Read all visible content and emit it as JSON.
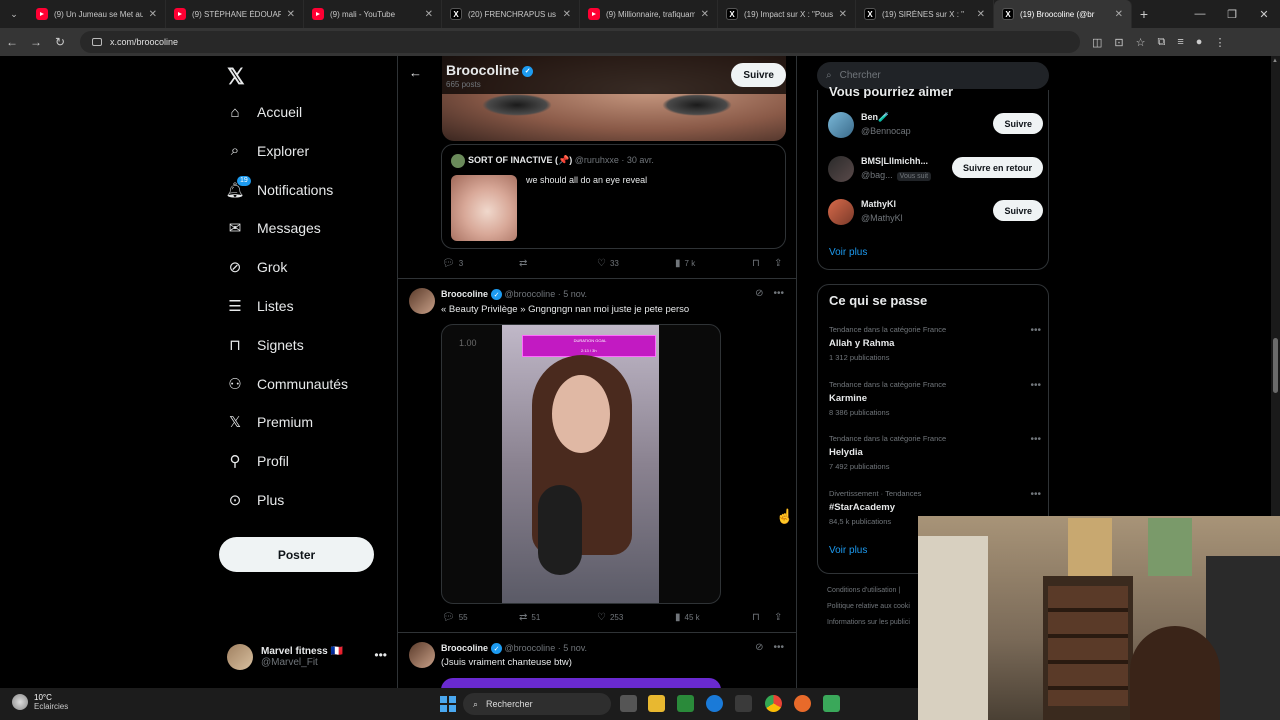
{
  "browser": {
    "tabs": [
      {
        "title": "(9) Un Jumeau se Met au",
        "icon": "youtube-icon"
      },
      {
        "title": "(9) STÉPHANE ÉDOUARD",
        "icon": "youtube-icon"
      },
      {
        "title": "(9) mali - YouTube",
        "icon": "youtube-icon"
      },
      {
        "title": "(20) FRENCHRAPUS us su",
        "icon": "x-icon"
      },
      {
        "title": "(9) Millionnaire, trafiquam",
        "icon": "youtube-icon"
      },
      {
        "title": "(19) Impact sur X : \"Pous",
        "icon": "x-icon"
      },
      {
        "title": "(19) SIRÈNES sur X : \"",
        "icon": "x-icon"
      },
      {
        "title": "(19) Broocoline (@br",
        "icon": "x-icon",
        "active": true
      }
    ],
    "url": "x.com/broocoline"
  },
  "sidebar": {
    "nav": [
      {
        "label": "Accueil",
        "icon": "home-icon"
      },
      {
        "label": "Explorer",
        "icon": "search-icon"
      },
      {
        "label": "Notifications",
        "icon": "bell-icon",
        "badge": "19"
      },
      {
        "label": "Messages",
        "icon": "envelope-icon"
      },
      {
        "label": "Grok",
        "icon": "grok-icon"
      },
      {
        "label": "Listes",
        "icon": "list-icon"
      },
      {
        "label": "Signets",
        "icon": "bookmark-icon"
      },
      {
        "label": "Communautés",
        "icon": "people-icon"
      },
      {
        "label": "Premium",
        "icon": "x-icon"
      },
      {
        "label": "Profil",
        "icon": "person-icon"
      },
      {
        "label": "Plus",
        "icon": "more-circle-icon"
      }
    ],
    "post_button": "Poster",
    "account": {
      "name": "Marvel fitness",
      "flag": "🇫🇷",
      "handle": "@Marvel_Fit"
    }
  },
  "profile_header": {
    "name": "Broocoline",
    "post_count": "665 posts",
    "follow_label": "Suivre"
  },
  "feed": {
    "quoted": {
      "name": "SORT OF INACTIVE (📌)",
      "handle": "@ruruhxxe",
      "date": "30 avr.",
      "text": "we should all do an eye reveal"
    },
    "tweet1_stats": {
      "replies": "3",
      "likes": "33",
      "views": "7 k"
    },
    "tweet2": {
      "name": "Broocoline",
      "handle": "@broocoline",
      "date": "5 nov.",
      "text": "« Beauty Privilège » Gngngngn nan moi juste je pete perso",
      "video_speed": "1.00",
      "overlay_title": "DURATION GOAL",
      "overlay_value": "2:13 / 3h",
      "stats": {
        "replies": "55",
        "retweets": "51",
        "likes": "253",
        "views": "45 k"
      }
    },
    "tweet3": {
      "name": "Broocoline",
      "handle": "@broocoline",
      "date": "5 nov.",
      "text": "(Jsuis vraiment chanteuse btw)"
    }
  },
  "right": {
    "search_placeholder": "Chercher",
    "who_to_follow": {
      "title": "Vous pourriez aimer",
      "users": [
        {
          "name": "Ben🧪",
          "handle": "@Bennocap",
          "button": "Suivre"
        },
        {
          "name": "BMS|Lllmichh...",
          "handle": "@bag...",
          "note": "Vous suit",
          "button": "Suivre en retour"
        },
        {
          "name": "MathyKl",
          "handle": "@MathyKl",
          "button": "Suivre"
        }
      ],
      "more": "Voir plus"
    },
    "trends": {
      "title": "Ce qui se passe",
      "items": [
        {
          "context": "Tendance dans la catégorie France",
          "name": "Allah y Rahma",
          "count": "1 312 publications"
        },
        {
          "context": "Tendance dans la catégorie France",
          "name": "Karmine",
          "count": "8 386 publications"
        },
        {
          "context": "Tendance dans la catégorie France",
          "name": "Helydia",
          "count": "7 492 publications"
        },
        {
          "context": "Divertissement · Tendances",
          "name": "#StarAcademy",
          "count": "84,5 k publications"
        }
      ],
      "more": "Voir plus"
    },
    "footer": [
      "Conditions d'utilisation |",
      "Politique relative aux cooki",
      "Informations sur les publici"
    ]
  },
  "taskbar": {
    "temp": "10°C",
    "weather": "Eclaircies",
    "search": "Rechercher"
  },
  "colors": {
    "accent": "#1d9bf0",
    "background": "#000000",
    "border": "#2f3336"
  }
}
